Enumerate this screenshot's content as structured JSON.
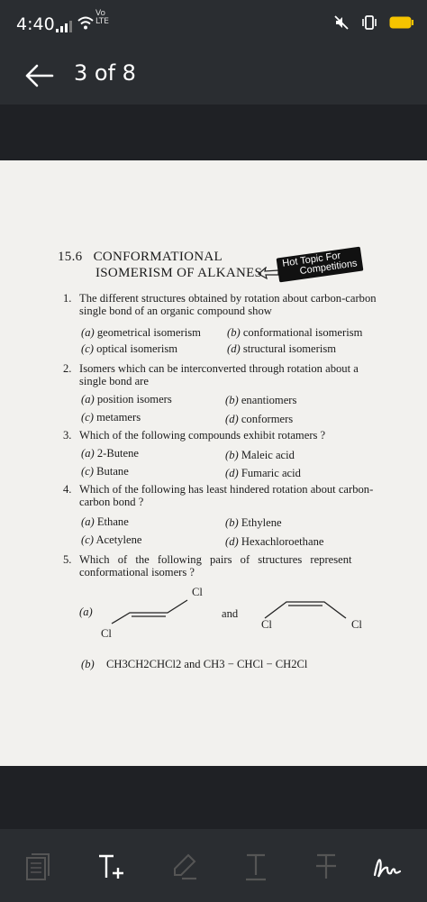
{
  "status_bar": {
    "time": "4:40",
    "network_top": "Vo",
    "network_bottom": "LTE"
  },
  "header": {
    "page_indicator": "3 of 8"
  },
  "document": {
    "section_number": "15.6",
    "section_title_line1": "CONFORMATIONAL",
    "section_title_line2": "ISOMERISM OF ALKANES",
    "badge_line1": "Hot Topic For",
    "badge_line2": "Competitions",
    "questions": [
      {
        "number": "1.",
        "text_line1": "The different structures obtained by rotation about carbon-carbon",
        "text_line2": "single bond of an organic compound show",
        "options": [
          {
            "label": "(a)",
            "text": "geometrical isomerism"
          },
          {
            "label": "(b)",
            "text": "conformational isomerism"
          },
          {
            "label": "(c)",
            "text": "optical isomerism"
          },
          {
            "label": "(d)",
            "text": "structural isomerism"
          }
        ]
      },
      {
        "number": "2.",
        "text_line1": "Isomers which can be interconverted through rotation about a",
        "text_line2": "single bond are",
        "options": [
          {
            "label": "(a)",
            "text": "position isomers"
          },
          {
            "label": "(b)",
            "text": "enantiomers"
          },
          {
            "label": "(c)",
            "text": "metamers"
          },
          {
            "label": "(d)",
            "text": "conformers"
          }
        ]
      },
      {
        "number": "3.",
        "text_line1": "Which of the following compounds exhibit rotamers ?",
        "text_line2": "",
        "options": [
          {
            "label": "(a)",
            "text": "2-Butene"
          },
          {
            "label": "(b)",
            "text": "Maleic acid"
          },
          {
            "label": "(c)",
            "text": "Butane"
          },
          {
            "label": "(d)",
            "text": "Fumaric acid"
          }
        ]
      },
      {
        "number": "4.",
        "text_line1": "Which of the following has least hindered rotation about carbon-",
        "text_line2": "carbon bond ?",
        "options": [
          {
            "label": "(a)",
            "text": "Ethane"
          },
          {
            "label": "(b)",
            "text": "Ethylene"
          },
          {
            "label": "(c)",
            "text": "Acetylene"
          },
          {
            "label": "(d)",
            "text": "Hexachloroethane"
          }
        ]
      },
      {
        "number": "5.",
        "text_line1": "Which of the following pairs of structures represent",
        "text_line2": "conformational isomers ?",
        "options": [
          {
            "label": "(a)",
            "text": "and",
            "cl_labels": [
              "Cl",
              "Cl",
              "Cl",
              "Cl"
            ]
          },
          {
            "label": "(b)",
            "formula_left": "CH3CH2CHCl2 and CH3 − CHCl − CH2Cl"
          }
        ]
      }
    ]
  },
  "toolbar": {
    "tools": [
      "page-view-icon",
      "add-text-icon",
      "highlighter-icon",
      "underline-text-icon",
      "strikethrough-text-icon",
      "signature-icon"
    ]
  }
}
